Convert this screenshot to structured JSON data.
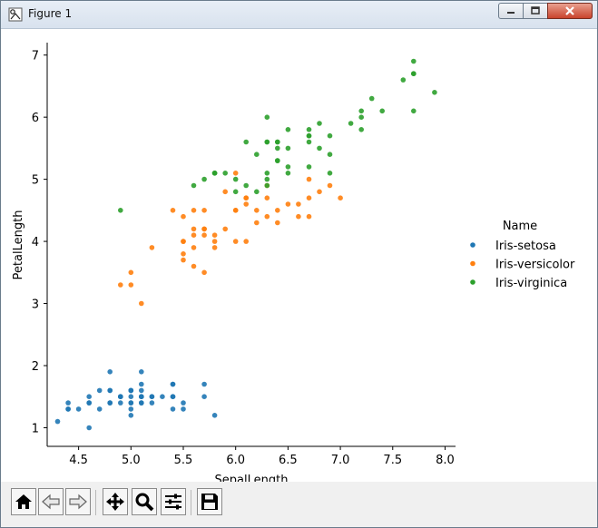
{
  "window": {
    "title": "Figure 1",
    "icons": {
      "app": "figure-icon",
      "minimize": "minimize-icon",
      "maximize": "maximize-icon",
      "close": "close-icon"
    }
  },
  "toolbar": {
    "buttons": [
      {
        "name": "home-button",
        "icon": "home-icon"
      },
      {
        "name": "back-button",
        "icon": "back-arrow-icon"
      },
      {
        "name": "forward-button",
        "icon": "forward-arrow-icon"
      },
      {
        "name": "pan-button",
        "icon": "move-icon"
      },
      {
        "name": "zoom-button",
        "icon": "zoom-icon"
      },
      {
        "name": "configure-subplots-button",
        "icon": "sliders-icon"
      },
      {
        "name": "save-button",
        "icon": "save-icon"
      }
    ]
  },
  "chart_data": {
    "type": "scatter",
    "title": "",
    "xlabel": "SepalLength",
    "ylabel": "PetalLength",
    "xlim": [
      4.2,
      8.1
    ],
    "ylim": [
      0.7,
      7.2
    ],
    "xticks": [
      "4.5",
      "5.0",
      "5.5",
      "6.0",
      "6.5",
      "7.0",
      "7.5",
      "8.0"
    ],
    "yticks": [
      "1",
      "2",
      "3",
      "4",
      "5",
      "6",
      "7"
    ],
    "grid": false,
    "legend": {
      "title": "Name",
      "placement": "right-outside"
    },
    "series": [
      {
        "name": "Iris-setosa",
        "color": "#1f77b4",
        "points": [
          [
            5.1,
            1.4
          ],
          [
            4.9,
            1.4
          ],
          [
            4.7,
            1.3
          ],
          [
            4.6,
            1.5
          ],
          [
            5.0,
            1.4
          ],
          [
            5.4,
            1.7
          ],
          [
            4.6,
            1.4
          ],
          [
            5.0,
            1.5
          ],
          [
            4.4,
            1.4
          ],
          [
            4.9,
            1.5
          ],
          [
            5.4,
            1.5
          ],
          [
            4.8,
            1.6
          ],
          [
            4.8,
            1.4
          ],
          [
            4.3,
            1.1
          ],
          [
            5.8,
            1.2
          ],
          [
            5.7,
            1.5
          ],
          [
            5.4,
            1.3
          ],
          [
            5.1,
            1.4
          ],
          [
            5.7,
            1.7
          ],
          [
            5.1,
            1.5
          ],
          [
            5.4,
            1.7
          ],
          [
            5.1,
            1.5
          ],
          [
            4.6,
            1.0
          ],
          [
            5.1,
            1.7
          ],
          [
            4.8,
            1.9
          ],
          [
            5.0,
            1.6
          ],
          [
            5.0,
            1.6
          ],
          [
            5.2,
            1.5
          ],
          [
            5.2,
            1.4
          ],
          [
            4.7,
            1.6
          ],
          [
            4.8,
            1.6
          ],
          [
            5.4,
            1.5
          ],
          [
            5.2,
            1.5
          ],
          [
            5.5,
            1.4
          ],
          [
            4.9,
            1.5
          ],
          [
            5.0,
            1.2
          ],
          [
            5.5,
            1.3
          ],
          [
            4.9,
            1.5
          ],
          [
            4.4,
            1.3
          ],
          [
            5.1,
            1.5
          ],
          [
            5.0,
            1.3
          ],
          [
            4.5,
            1.3
          ],
          [
            4.4,
            1.3
          ],
          [
            5.0,
            1.6
          ],
          [
            5.1,
            1.9
          ],
          [
            4.8,
            1.4
          ],
          [
            5.1,
            1.6
          ],
          [
            4.6,
            1.4
          ],
          [
            5.3,
            1.5
          ],
          [
            5.0,
            1.4
          ]
        ]
      },
      {
        "name": "Iris-versicolor",
        "color": "#ff7f0e",
        "points": [
          [
            7.0,
            4.7
          ],
          [
            6.4,
            4.5
          ],
          [
            6.9,
            4.9
          ],
          [
            5.5,
            4.0
          ],
          [
            6.5,
            4.6
          ],
          [
            5.7,
            4.5
          ],
          [
            6.3,
            4.7
          ],
          [
            4.9,
            3.3
          ],
          [
            6.6,
            4.6
          ],
          [
            5.2,
            3.9
          ],
          [
            5.0,
            3.5
          ],
          [
            5.9,
            4.2
          ],
          [
            6.0,
            4.0
          ],
          [
            6.1,
            4.7
          ],
          [
            5.6,
            3.6
          ],
          [
            6.7,
            4.4
          ],
          [
            5.6,
            4.5
          ],
          [
            5.8,
            4.1
          ],
          [
            6.2,
            4.5
          ],
          [
            5.6,
            3.9
          ],
          [
            5.9,
            4.8
          ],
          [
            6.1,
            4.0
          ],
          [
            6.3,
            4.9
          ],
          [
            6.1,
            4.7
          ],
          [
            6.4,
            4.3
          ],
          [
            6.6,
            4.4
          ],
          [
            6.8,
            4.8
          ],
          [
            6.7,
            5.0
          ],
          [
            6.0,
            4.5
          ],
          [
            5.7,
            3.5
          ],
          [
            5.5,
            3.8
          ],
          [
            5.5,
            3.7
          ],
          [
            5.8,
            3.9
          ],
          [
            6.0,
            5.1
          ],
          [
            5.4,
            4.5
          ],
          [
            6.0,
            4.5
          ],
          [
            6.7,
            4.7
          ],
          [
            6.3,
            4.4
          ],
          [
            5.6,
            4.1
          ],
          [
            5.5,
            4.0
          ],
          [
            5.5,
            4.4
          ],
          [
            6.1,
            4.6
          ],
          [
            5.8,
            4.0
          ],
          [
            5.0,
            3.3
          ],
          [
            5.6,
            4.2
          ],
          [
            5.7,
            4.2
          ],
          [
            5.7,
            4.2
          ],
          [
            6.2,
            4.3
          ],
          [
            5.1,
            3.0
          ],
          [
            5.7,
            4.1
          ]
        ]
      },
      {
        "name": "Iris-virginica",
        "color": "#2ca02c",
        "points": [
          [
            6.3,
            6.0
          ],
          [
            5.8,
            5.1
          ],
          [
            7.1,
            5.9
          ],
          [
            6.3,
            5.6
          ],
          [
            6.5,
            5.8
          ],
          [
            7.6,
            6.6
          ],
          [
            4.9,
            4.5
          ],
          [
            7.3,
            6.3
          ],
          [
            6.7,
            5.8
          ],
          [
            7.2,
            6.1
          ],
          [
            6.5,
            5.1
          ],
          [
            6.4,
            5.3
          ],
          [
            6.8,
            5.5
          ],
          [
            5.7,
            5.0
          ],
          [
            5.8,
            5.1
          ],
          [
            6.4,
            5.3
          ],
          [
            6.5,
            5.5
          ],
          [
            7.7,
            6.7
          ],
          [
            7.7,
            6.9
          ],
          [
            6.0,
            5.0
          ],
          [
            6.9,
            5.7
          ],
          [
            5.6,
            4.9
          ],
          [
            7.7,
            6.7
          ],
          [
            6.3,
            4.9
          ],
          [
            6.7,
            5.7
          ],
          [
            7.2,
            6.0
          ],
          [
            6.2,
            4.8
          ],
          [
            6.1,
            4.9
          ],
          [
            6.4,
            5.6
          ],
          [
            7.2,
            5.8
          ],
          [
            7.4,
            6.1
          ],
          [
            7.9,
            6.4
          ],
          [
            6.4,
            5.6
          ],
          [
            6.3,
            5.1
          ],
          [
            6.1,
            5.6
          ],
          [
            7.7,
            6.1
          ],
          [
            6.3,
            5.6
          ],
          [
            6.4,
            5.5
          ],
          [
            6.0,
            4.8
          ],
          [
            6.9,
            5.4
          ],
          [
            6.7,
            5.6
          ],
          [
            6.9,
            5.1
          ],
          [
            5.8,
            5.1
          ],
          [
            6.8,
            5.9
          ],
          [
            6.7,
            5.7
          ],
          [
            6.7,
            5.2
          ],
          [
            6.3,
            5.0
          ],
          [
            6.5,
            5.2
          ],
          [
            6.2,
            5.4
          ],
          [
            5.9,
            5.1
          ]
        ]
      }
    ]
  }
}
